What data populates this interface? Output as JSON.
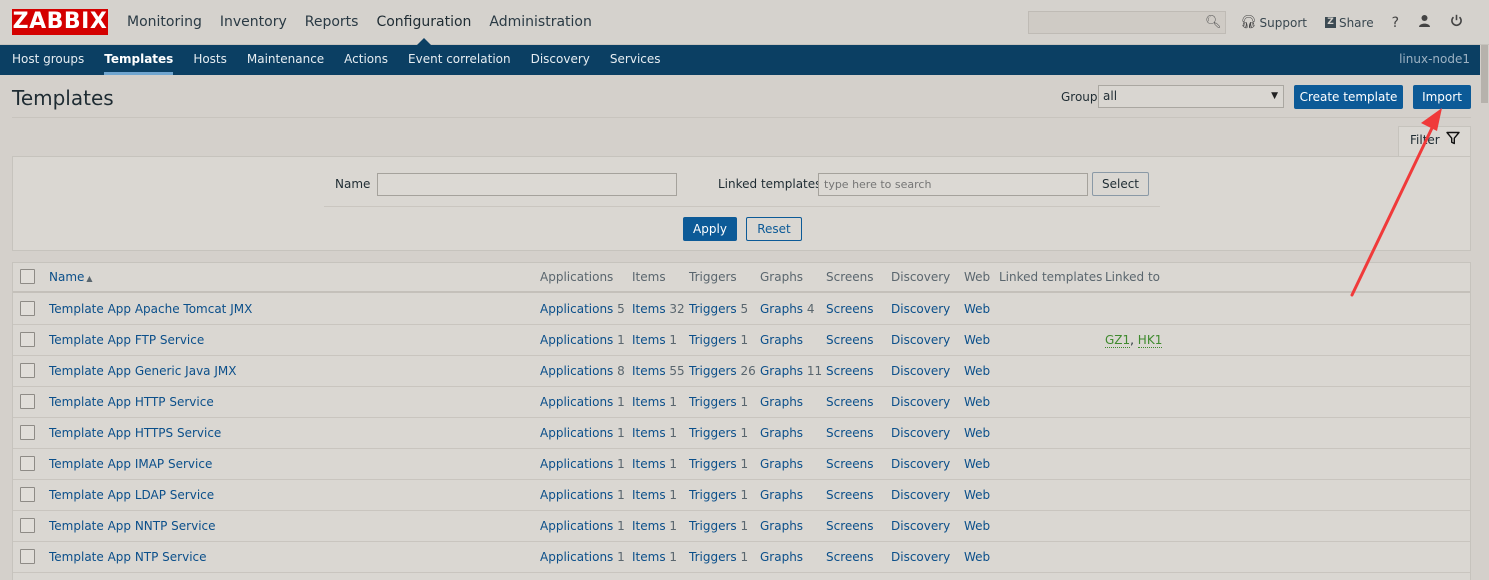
{
  "logo": "ZABBIX",
  "main_menu": [
    {
      "label": "Monitoring",
      "active": false
    },
    {
      "label": "Inventory",
      "active": false
    },
    {
      "label": "Reports",
      "active": false
    },
    {
      "label": "Configuration",
      "active": true
    },
    {
      "label": "Administration",
      "active": false
    }
  ],
  "top_right": {
    "support_label": "Support",
    "share_label": "Share",
    "help_glyph": "?"
  },
  "sub_menu": [
    {
      "label": "Host groups",
      "active": false
    },
    {
      "label": "Templates",
      "active": true
    },
    {
      "label": "Hosts",
      "active": false
    },
    {
      "label": "Maintenance",
      "active": false
    },
    {
      "label": "Actions",
      "active": false
    },
    {
      "label": "Event correlation",
      "active": false
    },
    {
      "label": "Discovery",
      "active": false
    },
    {
      "label": "Services",
      "active": false
    }
  ],
  "node_name": "linux-node1",
  "header": {
    "title": "Templates",
    "group_label": "Group",
    "group_value": "all",
    "create_button": "Create template",
    "import_button": "Import"
  },
  "filter": {
    "tab_label": "Filter",
    "name_label": "Name",
    "name_value": "",
    "linked_label": "Linked templates",
    "linked_placeholder": "type here to search",
    "select_button": "Select",
    "apply_button": "Apply",
    "reset_button": "Reset"
  },
  "table": {
    "columns": {
      "name": "Name",
      "applications": "Applications",
      "items": "Items",
      "triggers": "Triggers",
      "graphs": "Graphs",
      "screens": "Screens",
      "discovery": "Discovery",
      "web": "Web",
      "linked_templates": "Linked templates",
      "linked_to": "Linked to"
    },
    "rows": [
      {
        "name": "Template App Apache Tomcat JMX",
        "app_label": "Applications",
        "app_count": "5",
        "items_label": "Items",
        "items_count": "32",
        "triggers_label": "Triggers",
        "triggers_count": "5",
        "graphs_label": "Graphs",
        "graphs_count": "4",
        "screens": "Screens",
        "discovery": "Discovery",
        "web": "Web",
        "linked_to": []
      },
      {
        "name": "Template App FTP Service",
        "app_label": "Applications",
        "app_count": "1",
        "items_label": "Items",
        "items_count": "1",
        "triggers_label": "Triggers",
        "triggers_count": "1",
        "graphs_label": "Graphs",
        "graphs_count": "",
        "screens": "Screens",
        "discovery": "Discovery",
        "web": "Web",
        "linked_to": [
          "GZ1",
          "HK1"
        ]
      },
      {
        "name": "Template App Generic Java JMX",
        "app_label": "Applications",
        "app_count": "8",
        "items_label": "Items",
        "items_count": "55",
        "triggers_label": "Triggers",
        "triggers_count": "26",
        "graphs_label": "Graphs",
        "graphs_count": "11",
        "screens": "Screens",
        "discovery": "Discovery",
        "web": "Web",
        "linked_to": []
      },
      {
        "name": "Template App HTTP Service",
        "app_label": "Applications",
        "app_count": "1",
        "items_label": "Items",
        "items_count": "1",
        "triggers_label": "Triggers",
        "triggers_count": "1",
        "graphs_label": "Graphs",
        "graphs_count": "",
        "screens": "Screens",
        "discovery": "Discovery",
        "web": "Web",
        "linked_to": []
      },
      {
        "name": "Template App HTTPS Service",
        "app_label": "Applications",
        "app_count": "1",
        "items_label": "Items",
        "items_count": "1",
        "triggers_label": "Triggers",
        "triggers_count": "1",
        "graphs_label": "Graphs",
        "graphs_count": "",
        "screens": "Screens",
        "discovery": "Discovery",
        "web": "Web",
        "linked_to": []
      },
      {
        "name": "Template App IMAP Service",
        "app_label": "Applications",
        "app_count": "1",
        "items_label": "Items",
        "items_count": "1",
        "triggers_label": "Triggers",
        "triggers_count": "1",
        "graphs_label": "Graphs",
        "graphs_count": "",
        "screens": "Screens",
        "discovery": "Discovery",
        "web": "Web",
        "linked_to": []
      },
      {
        "name": "Template App LDAP Service",
        "app_label": "Applications",
        "app_count": "1",
        "items_label": "Items",
        "items_count": "1",
        "triggers_label": "Triggers",
        "triggers_count": "1",
        "graphs_label": "Graphs",
        "graphs_count": "",
        "screens": "Screens",
        "discovery": "Discovery",
        "web": "Web",
        "linked_to": []
      },
      {
        "name": "Template App NNTP Service",
        "app_label": "Applications",
        "app_count": "1",
        "items_label": "Items",
        "items_count": "1",
        "triggers_label": "Triggers",
        "triggers_count": "1",
        "graphs_label": "Graphs",
        "graphs_count": "",
        "screens": "Screens",
        "discovery": "Discovery",
        "web": "Web",
        "linked_to": []
      },
      {
        "name": "Template App NTP Service",
        "app_label": "Applications",
        "app_count": "1",
        "items_label": "Items",
        "items_count": "1",
        "triggers_label": "Triggers",
        "triggers_count": "1",
        "graphs_label": "Graphs",
        "graphs_count": "",
        "screens": "Screens",
        "discovery": "Discovery",
        "web": "Web",
        "linked_to": []
      }
    ]
  },
  "colors": {
    "brand_red": "#d40000",
    "nav_dark": "#0b3f63",
    "button_blue": "#0c5a97",
    "link_blue": "#0b4f8a",
    "linked_green": "#3f8a2e",
    "annotation_red": "#f03a3a"
  }
}
